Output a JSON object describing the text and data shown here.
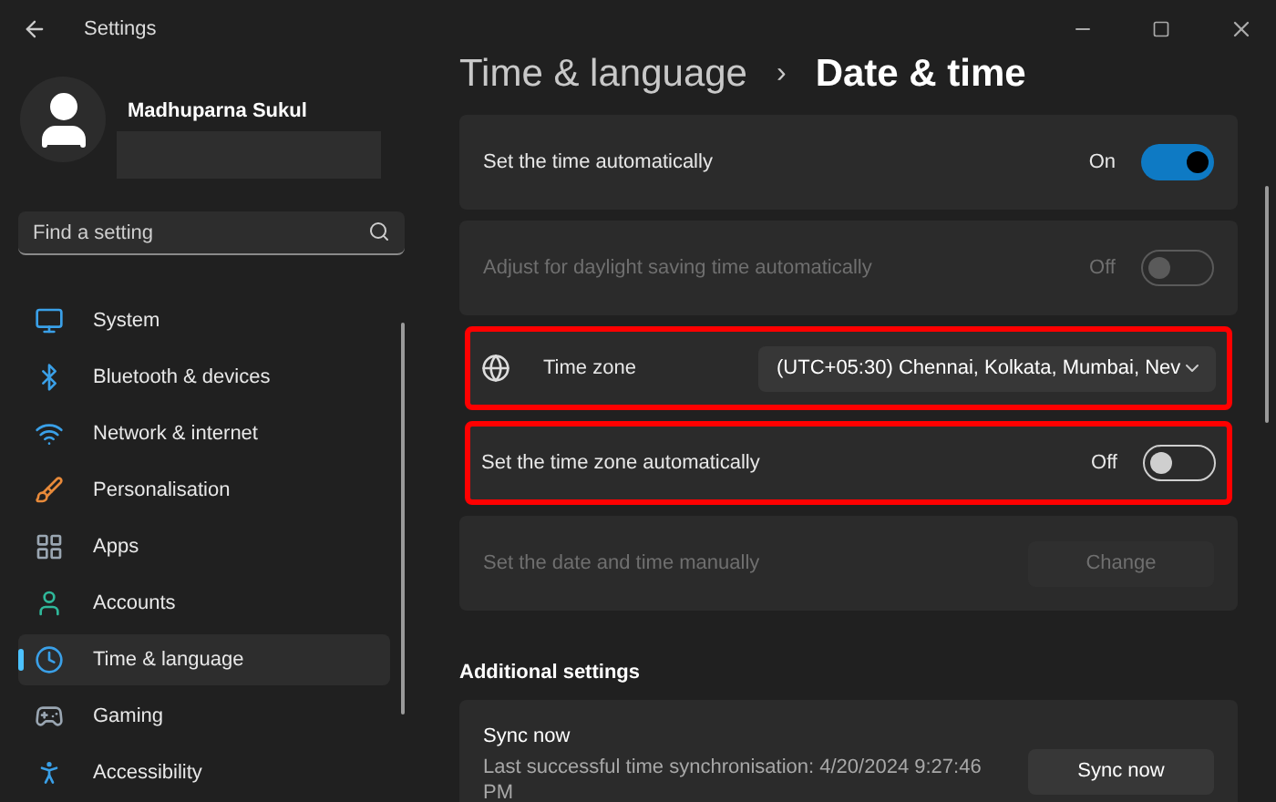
{
  "window": {
    "title": "Settings"
  },
  "user": {
    "name": "Madhuparna Sukul"
  },
  "search": {
    "placeholder": "Find a setting"
  },
  "sidebar": {
    "items": [
      {
        "label": "System",
        "selected": false
      },
      {
        "label": "Bluetooth & devices",
        "selected": false
      },
      {
        "label": "Network & internet",
        "selected": false
      },
      {
        "label": "Personalisation",
        "selected": false
      },
      {
        "label": "Apps",
        "selected": false
      },
      {
        "label": "Accounts",
        "selected": false
      },
      {
        "label": "Time & language",
        "selected": true
      },
      {
        "label": "Gaming",
        "selected": false
      },
      {
        "label": "Accessibility",
        "selected": false
      }
    ]
  },
  "breadcrumb": {
    "parent": "Time & language",
    "separator": "›",
    "current": "Date & time"
  },
  "settings": [
    {
      "kind": "toggle",
      "label": "Set the time automatically",
      "value": "On",
      "on": true,
      "disabled": false,
      "highlighted": false
    },
    {
      "kind": "toggle",
      "label": "Adjust for daylight saving time automatically",
      "value": "Off",
      "on": false,
      "disabled": true,
      "highlighted": false
    },
    {
      "kind": "dropdown",
      "label": "Time zone",
      "value": "(UTC+05:30) Chennai, Kolkata, Mumbai, Nev",
      "highlighted": true
    },
    {
      "kind": "toggle",
      "label": "Set the time zone automatically",
      "value": "Off",
      "on": false,
      "disabled": false,
      "highlighted": true
    },
    {
      "kind": "button",
      "label": "Set the date and time manually",
      "button": "Change",
      "disabled": true,
      "highlighted": false
    }
  ],
  "additional": {
    "heading": "Additional settings",
    "title": "Sync now",
    "description": "Last successful time synchronisation: 4/20/2024 9:27:46 PM",
    "button": "Sync now"
  }
}
